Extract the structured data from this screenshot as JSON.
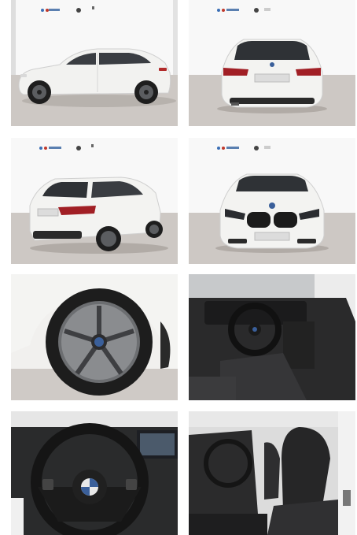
{
  "gallery": {
    "photos": [
      {
        "subject": "side-exterior"
      },
      {
        "subject": "rear-exterior"
      },
      {
        "subject": "rear-three-quarter-exterior"
      },
      {
        "subject": "front-exterior"
      },
      {
        "subject": "alloy-wheel"
      },
      {
        "subject": "dashboard-interior"
      },
      {
        "subject": "steering-wheel"
      },
      {
        "subject": "front-seats-interior"
      }
    ]
  },
  "colors": {
    "car_body": "#f3f3f1",
    "showroom_wall": "#f7f7f7",
    "showroom_floor": "#cfcac6",
    "tyre": "#1f1f1f",
    "rim": "#6b6d70",
    "interior": "#2a2a2b"
  }
}
